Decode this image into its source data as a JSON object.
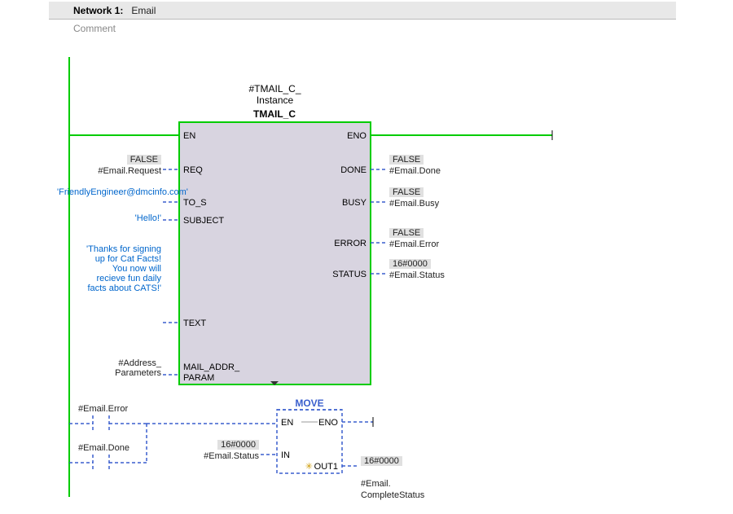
{
  "network": {
    "label": "Network 1:",
    "title": "Email",
    "comment_placeholder": "Comment"
  },
  "block1": {
    "instance": "#TMAIL_C_\nInstance",
    "type": "TMAIL_C",
    "inputs": {
      "en": "EN",
      "req": "REQ",
      "to_s": "TO_S",
      "subject": "SUBJECT",
      "text": "TEXT",
      "mail_addr": "MAIL_ADDR_\nPARAM"
    },
    "outputs": {
      "eno": "ENO",
      "done": "DONE",
      "busy": "BUSY",
      "error": "ERROR",
      "status": "STATUS"
    },
    "in_params": {
      "req": {
        "value": "FALSE",
        "tag": "#Email.Request"
      },
      "to_s": "'FriendlyEngineer@dmcinfo.com'",
      "subject": "'Hello!'",
      "text": "'Thanks for signing up for Cat Facts! You now will recieve fun daily facts about CATS!'",
      "mail_addr": "#Address_\nParameters"
    },
    "out_params": {
      "done": {
        "value": "FALSE",
        "tag": "#Email.Done"
      },
      "busy": {
        "value": "FALSE",
        "tag": "#Email.Busy"
      },
      "error": {
        "value": "FALSE",
        "tag": "#Email.Error"
      },
      "status": {
        "value": "16#0000",
        "tag": "#Email.Status"
      }
    }
  },
  "contacts": {
    "error": "#Email.Error",
    "done": "#Email.Done"
  },
  "block2": {
    "type": "MOVE",
    "inputs": {
      "en": "EN",
      "in": "IN"
    },
    "outputs": {
      "eno": "ENO",
      "out1": "OUT1"
    },
    "in_params": {
      "in": {
        "value": "16#0000",
        "tag": "#Email.Status"
      }
    },
    "out_params": {
      "out1": {
        "value": "16#0000",
        "tag": "#Email.\nCompleteStatus"
      }
    },
    "out1_marker": "✳"
  }
}
